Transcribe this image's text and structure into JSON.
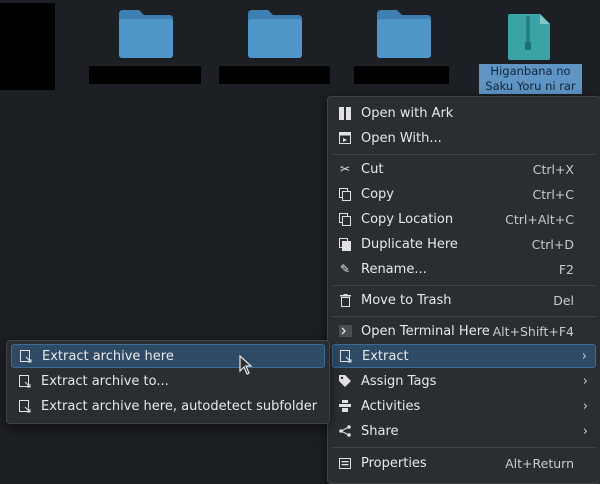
{
  "files": {
    "archive_label_line1": "Higanbana no",
    "archive_label_line2": "Saku Yoru ni rar"
  },
  "context_menu": {
    "items": [
      {
        "label": "Open with Ark",
        "shortcut": "",
        "icon": "ark-icon"
      },
      {
        "label": "Open With...",
        "shortcut": "",
        "icon": "open-with-icon"
      },
      {
        "label": "Cut",
        "shortcut": "Ctrl+X",
        "icon": "scissors-icon"
      },
      {
        "label": "Copy",
        "shortcut": "Ctrl+C",
        "icon": "copy-icon"
      },
      {
        "label": "Copy Location",
        "shortcut": "Ctrl+Alt+C",
        "icon": "copy-location-icon"
      },
      {
        "label": "Duplicate Here",
        "shortcut": "Ctrl+D",
        "icon": "duplicate-icon"
      },
      {
        "label": "Rename...",
        "shortcut": "F2",
        "icon": "rename-icon"
      },
      {
        "label": "Move to Trash",
        "shortcut": "Del",
        "icon": "trash-icon"
      },
      {
        "label": "Open Terminal Here",
        "shortcut": "Alt+Shift+F4",
        "icon": "terminal-icon"
      },
      {
        "label": "Extract",
        "shortcut": "",
        "icon": "extract-icon"
      },
      {
        "label": "Assign Tags",
        "shortcut": "",
        "icon": "tag-icon"
      },
      {
        "label": "Activities",
        "shortcut": "",
        "icon": "activities-icon"
      },
      {
        "label": "Share",
        "shortcut": "",
        "icon": "share-icon"
      },
      {
        "label": "Properties",
        "shortcut": "Alt+Return",
        "icon": "properties-icon"
      }
    ]
  },
  "extract_submenu": {
    "items": [
      {
        "label": "Extract archive here"
      },
      {
        "label": "Extract archive to..."
      },
      {
        "label": "Extract archive here, autodetect subfolder"
      }
    ]
  },
  "colors": {
    "folder": "#4f96c8",
    "selection": "#5e95c5",
    "highlight": "#2f4a64",
    "archive": "#3aa3a6"
  }
}
